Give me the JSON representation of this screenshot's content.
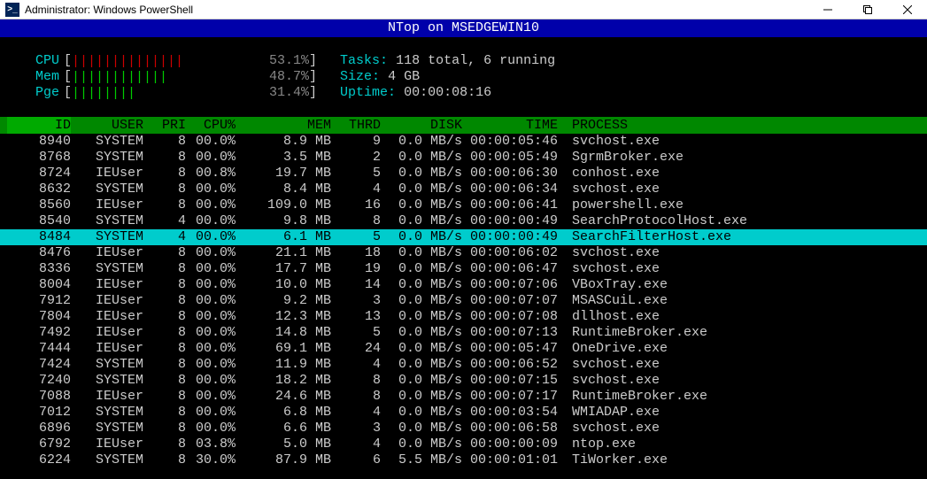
{
  "window": {
    "title": "Administrator: Windows PowerShell",
    "icon_label": ">_"
  },
  "app": {
    "heading": "NTop on MSEDGEWIN10"
  },
  "summary": {
    "cpu": {
      "label": "CPU",
      "pct": "53.1%",
      "bar_ticks": "||||||||||||||",
      "bar_color": "red"
    },
    "mem": {
      "label": "Mem",
      "pct": "48.7%",
      "bar_ticks": "||||||||||||",
      "bar_color": "green"
    },
    "page": {
      "label": "Pge",
      "pct": "31.4%",
      "bar_ticks": "||||||||",
      "bar_color": "green"
    },
    "tasks_label": "Tasks:",
    "tasks_value": "118 total, 6 running",
    "size_label": "Size:",
    "size_value": "4 GB",
    "uptime_label": "Uptime:",
    "uptime_value": "00:00:08:16"
  },
  "columns": {
    "id": "ID",
    "user": "USER",
    "pri": "PRI",
    "cpu": "CPU%",
    "mem": "MEM",
    "thrd": "THRD",
    "disk": "DISK",
    "time": "TIME",
    "proc": "PROCESS"
  },
  "processes": [
    {
      "id": "8940",
      "user": "SYSTEM",
      "pri": "8",
      "cpu": "00.0%",
      "mem": "8.9 MB",
      "thrd": "9",
      "disk": "0.0 MB/s",
      "time": "00:00:05:46",
      "proc": "svchost.exe",
      "hl": false
    },
    {
      "id": "8768",
      "user": "SYSTEM",
      "pri": "8",
      "cpu": "00.0%",
      "mem": "3.5 MB",
      "thrd": "2",
      "disk": "0.0 MB/s",
      "time": "00:00:05:49",
      "proc": "SgrmBroker.exe",
      "hl": false
    },
    {
      "id": "8724",
      "user": "IEUser",
      "pri": "8",
      "cpu": "00.8%",
      "mem": "19.7 MB",
      "thrd": "5",
      "disk": "0.0 MB/s",
      "time": "00:00:06:30",
      "proc": "conhost.exe",
      "hl": false
    },
    {
      "id": "8632",
      "user": "SYSTEM",
      "pri": "8",
      "cpu": "00.0%",
      "mem": "8.4 MB",
      "thrd": "4",
      "disk": "0.0 MB/s",
      "time": "00:00:06:34",
      "proc": "svchost.exe",
      "hl": false
    },
    {
      "id": "8560",
      "user": "IEUser",
      "pri": "8",
      "cpu": "00.0%",
      "mem": "109.0 MB",
      "thrd": "16",
      "disk": "0.0 MB/s",
      "time": "00:00:06:41",
      "proc": "powershell.exe",
      "hl": false
    },
    {
      "id": "8540",
      "user": "SYSTEM",
      "pri": "4",
      "cpu": "00.0%",
      "mem": "9.8 MB",
      "thrd": "8",
      "disk": "0.0 MB/s",
      "time": "00:00:00:49",
      "proc": "SearchProtocolHost.exe",
      "hl": false
    },
    {
      "id": "8484",
      "user": "SYSTEM",
      "pri": "4",
      "cpu": "00.0%",
      "mem": "6.1 MB",
      "thrd": "5",
      "disk": "0.0 MB/s",
      "time": "00:00:00:49",
      "proc": "SearchFilterHost.exe",
      "hl": true
    },
    {
      "id": "8476",
      "user": "IEUser",
      "pri": "8",
      "cpu": "00.0%",
      "mem": "21.1 MB",
      "thrd": "18",
      "disk": "0.0 MB/s",
      "time": "00:00:06:02",
      "proc": "svchost.exe",
      "hl": false
    },
    {
      "id": "8336",
      "user": "SYSTEM",
      "pri": "8",
      "cpu": "00.0%",
      "mem": "17.7 MB",
      "thrd": "19",
      "disk": "0.0 MB/s",
      "time": "00:00:06:47",
      "proc": "svchost.exe",
      "hl": false
    },
    {
      "id": "8004",
      "user": "IEUser",
      "pri": "8",
      "cpu": "00.0%",
      "mem": "10.0 MB",
      "thrd": "14",
      "disk": "0.0 MB/s",
      "time": "00:00:07:06",
      "proc": "VBoxTray.exe",
      "hl": false
    },
    {
      "id": "7912",
      "user": "IEUser",
      "pri": "8",
      "cpu": "00.0%",
      "mem": "9.2 MB",
      "thrd": "3",
      "disk": "0.0 MB/s",
      "time": "00:00:07:07",
      "proc": "MSASCuiL.exe",
      "hl": false
    },
    {
      "id": "7804",
      "user": "IEUser",
      "pri": "8",
      "cpu": "00.0%",
      "mem": "12.3 MB",
      "thrd": "13",
      "disk": "0.0 MB/s",
      "time": "00:00:07:08",
      "proc": "dllhost.exe",
      "hl": false
    },
    {
      "id": "7492",
      "user": "IEUser",
      "pri": "8",
      "cpu": "00.0%",
      "mem": "14.8 MB",
      "thrd": "5",
      "disk": "0.0 MB/s",
      "time": "00:00:07:13",
      "proc": "RuntimeBroker.exe",
      "hl": false
    },
    {
      "id": "7444",
      "user": "IEUser",
      "pri": "8",
      "cpu": "00.0%",
      "mem": "69.1 MB",
      "thrd": "24",
      "disk": "0.0 MB/s",
      "time": "00:00:05:47",
      "proc": "OneDrive.exe",
      "hl": false
    },
    {
      "id": "7424",
      "user": "SYSTEM",
      "pri": "8",
      "cpu": "00.0%",
      "mem": "11.9 MB",
      "thrd": "4",
      "disk": "0.0 MB/s",
      "time": "00:00:06:52",
      "proc": "svchost.exe",
      "hl": false
    },
    {
      "id": "7240",
      "user": "SYSTEM",
      "pri": "8",
      "cpu": "00.0%",
      "mem": "18.2 MB",
      "thrd": "8",
      "disk": "0.0 MB/s",
      "time": "00:00:07:15",
      "proc": "svchost.exe",
      "hl": false
    },
    {
      "id": "7088",
      "user": "IEUser",
      "pri": "8",
      "cpu": "00.0%",
      "mem": "24.6 MB",
      "thrd": "8",
      "disk": "0.0 MB/s",
      "time": "00:00:07:17",
      "proc": "RuntimeBroker.exe",
      "hl": false
    },
    {
      "id": "7012",
      "user": "SYSTEM",
      "pri": "8",
      "cpu": "00.0%",
      "mem": "6.8 MB",
      "thrd": "4",
      "disk": "0.0 MB/s",
      "time": "00:00:03:54",
      "proc": "WMIADAP.exe",
      "hl": false
    },
    {
      "id": "6896",
      "user": "SYSTEM",
      "pri": "8",
      "cpu": "00.0%",
      "mem": "6.6 MB",
      "thrd": "3",
      "disk": "0.0 MB/s",
      "time": "00:00:06:58",
      "proc": "svchost.exe",
      "hl": false
    },
    {
      "id": "6792",
      "user": "IEUser",
      "pri": "8",
      "cpu": "03.8%",
      "mem": "5.0 MB",
      "thrd": "4",
      "disk": "0.0 MB/s",
      "time": "00:00:00:09",
      "proc": "ntop.exe",
      "hl": false
    },
    {
      "id": "6224",
      "user": "SYSTEM",
      "pri": "8",
      "cpu": "30.0%",
      "mem": "87.9 MB",
      "thrd": "6",
      "disk": "5.5 MB/s",
      "time": "00:00:01:01",
      "proc": "TiWorker.exe",
      "hl": false
    }
  ]
}
